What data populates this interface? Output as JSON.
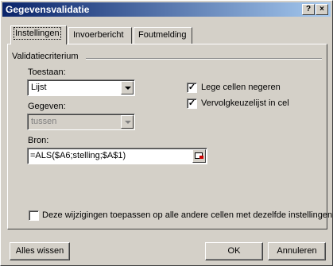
{
  "window": {
    "title": "Gegevensvalidatie"
  },
  "tabs": [
    {
      "label": "Instellingen",
      "active": true
    },
    {
      "label": "Invoerbericht",
      "active": false
    },
    {
      "label": "Foutmelding",
      "active": false
    }
  ],
  "criteria": {
    "group_label": "Validatiecriterium",
    "toestaan_label": "Toestaan:",
    "toestaan_value": "Lijst",
    "gegeven_label": "Gegeven:",
    "gegeven_value": "tussen",
    "bron_label": "Bron:",
    "bron_value": "=ALS($A6;stelling;$A$1)"
  },
  "checkboxes": {
    "lege_cellen": {
      "label": "Lege cellen negeren",
      "checked": true
    },
    "vervolgkeuzelijst": {
      "label": "Vervolgkeuzelijst in cel",
      "checked": true
    },
    "apply_all": {
      "label": "Deze wijzigingen toepassen op alle andere cellen met dezelfde instellingen",
      "checked": false
    }
  },
  "buttons": {
    "clear": "Alles wissen",
    "ok": "OK",
    "cancel": "Annuleren"
  },
  "titlebar_buttons": {
    "help": "?",
    "close": "×"
  }
}
